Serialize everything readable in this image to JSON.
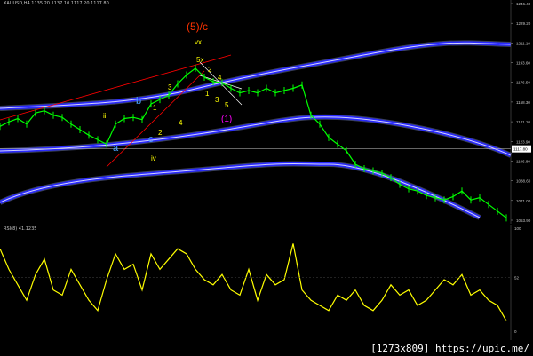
{
  "header": {
    "symbol_line": "XAUUSD,H4 1135.20 1137.10 1117.20 1117.80",
    "rsi_line": "RSI(8) 41.1235"
  },
  "watermark": "[1273x809] https://upic.me/",
  "current_price": "1117.80",
  "price_axis": [
    "1246.40",
    "1229.20",
    "1211.10",
    "1193.60",
    "1176.50",
    "1158.30",
    "1141.10",
    "1123.90",
    "1106.80",
    "1088.60",
    "1071.00",
    "1053.90"
  ],
  "rsi_axis": [
    "100",
    "52",
    "0"
  ],
  "wave_labels": {
    "big": "(5)/c",
    "vx": "vx",
    "five_x": "5x",
    "p1": "1",
    "p2": "2",
    "p3": "3",
    "p4": "4",
    "q1": "1",
    "q2": "2",
    "q3": "3",
    "q4": "4",
    "q5": "5",
    "b": "b",
    "a": "a",
    "c": "c",
    "iii": "iii",
    "iv": "iv",
    "paren1": "(1)"
  },
  "colors": {
    "background": "#000000",
    "bull_candle": "#00ff00",
    "channel_blue": "#2a2aff",
    "channel_glow": "#a0b4ff",
    "rsi_line": "#ffff00",
    "trend_red": "#ff0000",
    "wave_yellow": "#ffff00",
    "wave_blue": "#4aa4ff",
    "wave_magenta": "#ff00ff",
    "wave_red_big": "#ff3300"
  },
  "chart_data": {
    "type": "line",
    "series": [
      {
        "name": "XAUUSD,H4",
        "x": [
          0,
          10,
          20,
          30,
          40,
          50,
          60,
          70,
          80,
          90,
          100,
          110,
          120,
          130,
          140,
          150,
          160,
          170,
          180,
          190,
          200,
          210,
          220,
          230,
          240,
          250,
          260,
          270,
          280,
          290,
          300,
          310,
          320,
          330,
          340,
          350,
          360,
          370,
          380,
          390,
          400,
          410,
          420,
          430,
          440,
          450,
          460,
          470,
          480,
          490,
          500,
          510,
          520,
          530,
          540,
          550,
          560,
          570
        ],
        "values": [
          1138,
          1142,
          1145,
          1140,
          1150,
          1152,
          1148,
          1146,
          1140,
          1135,
          1130,
          1126,
          1122,
          1140,
          1145,
          1146,
          1144,
          1158,
          1162,
          1166,
          1176,
          1184,
          1190,
          1182,
          1178,
          1177,
          1172,
          1168,
          1170,
          1168,
          1172,
          1168,
          1170,
          1172,
          1175,
          1148,
          1140,
          1128,
          1122,
          1116,
          1104,
          1100,
          1098,
          1096,
          1092,
          1086,
          1082,
          1080,
          1076,
          1074,
          1072,
          1075,
          1080,
          1072,
          1074,
          1068,
          1062,
          1056
        ]
      },
      {
        "name": "RSI(8)",
        "x": [
          0,
          10,
          20,
          30,
          40,
          50,
          60,
          70,
          80,
          90,
          100,
          110,
          120,
          130,
          140,
          150,
          160,
          170,
          180,
          190,
          200,
          210,
          220,
          230,
          240,
          250,
          260,
          270,
          280,
          290,
          300,
          310,
          320,
          330,
          340,
          350,
          360,
          370,
          380,
          390,
          400,
          410,
          420,
          430,
          440,
          450,
          460,
          470,
          480,
          490,
          500,
          510,
          520,
          530,
          540,
          550,
          560,
          570
        ],
        "values": [
          80,
          60,
          45,
          30,
          55,
          70,
          40,
          35,
          60,
          45,
          30,
          20,
          50,
          75,
          60,
          65,
          40,
          75,
          60,
          70,
          80,
          75,
          60,
          50,
          45,
          55,
          40,
          35,
          60,
          30,
          55,
          45,
          50,
          85,
          40,
          30,
          25,
          20,
          35,
          30,
          40,
          25,
          20,
          30,
          45,
          35,
          40,
          25,
          30,
          40,
          50,
          45,
          55,
          35,
          40,
          30,
          25,
          10
        ],
        "ylim": [
          0,
          100
        ]
      }
    ],
    "ylim": [
      1053.9,
      1246.4
    ],
    "grid": false
  }
}
